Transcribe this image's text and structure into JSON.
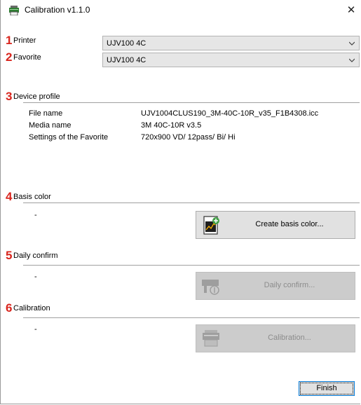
{
  "window": {
    "title": "Calibration  v1.1.0",
    "close_glyph": "✕"
  },
  "sections": {
    "printer": {
      "number": "1",
      "label": "Printer",
      "value": "UJV100 4C"
    },
    "favorite": {
      "number": "2",
      "label": "Favorite",
      "value": "UJV100 4C"
    },
    "device_profile": {
      "number": "3",
      "label": "Device profile",
      "file_name_label": "File name",
      "file_name": "UJV1004CLUS190_3M-40C-10R_v35_F1B4308.icc",
      "media_name_label": "Media name",
      "media_name": "3M 40C-10R v3.5",
      "settings_label": "Settings of the Favorite",
      "settings": "720x900 VD/ 12pass/ Bi/ Hi"
    },
    "basis_color": {
      "number": "4",
      "label": "Basis color",
      "status": "-",
      "button": "Create basis color...",
      "icon": "create-basis-color-icon"
    },
    "daily_confirm": {
      "number": "5",
      "label": "Daily confirm",
      "status": "-",
      "button": "Daily confirm...",
      "icon": "printer-check-icon"
    },
    "calibration": {
      "number": "6",
      "label": "Calibration",
      "status": "-",
      "button": "Calibration...",
      "icon": "printer-icon"
    }
  },
  "footer": {
    "finish_label": "Finish"
  },
  "colors": {
    "step_number": "#d9251d",
    "disabled_button": "#cccccc",
    "enabled_button": "#e1e1e1"
  }
}
